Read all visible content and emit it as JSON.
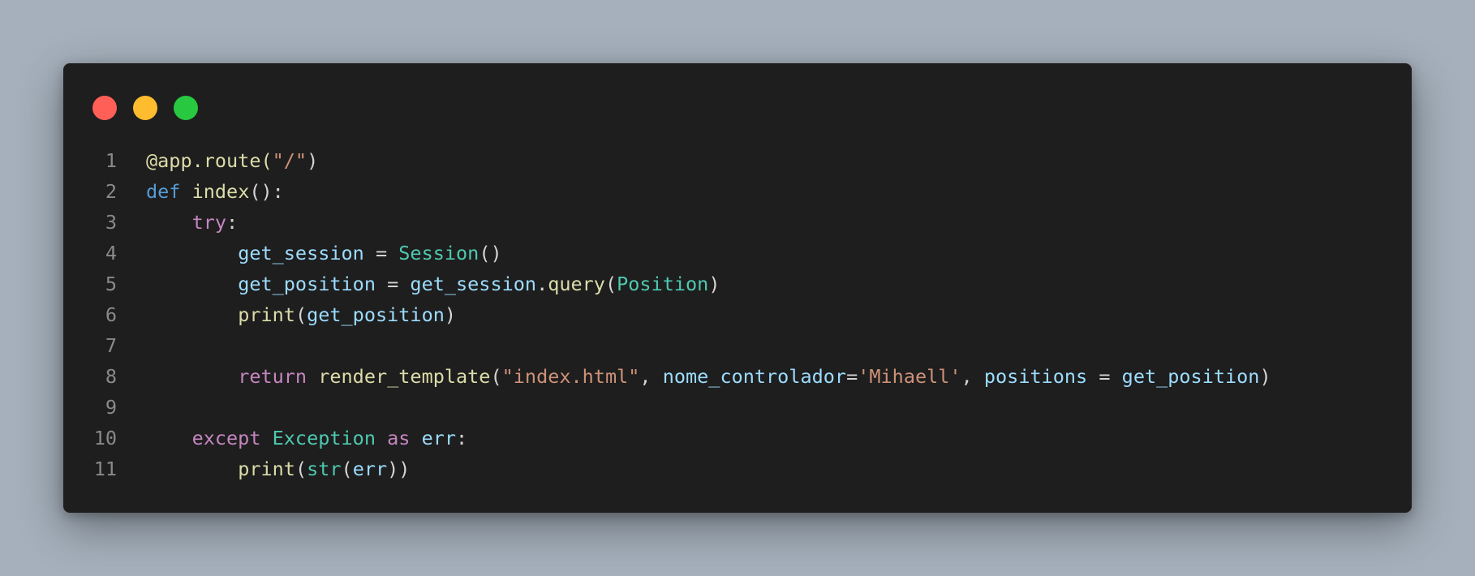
{
  "colors": {
    "background": "#a5b0bc",
    "window": "#1e1e1e",
    "close": "#ff5f57",
    "minimize": "#febc2e",
    "zoom": "#28c840"
  },
  "window_controls": [
    "close-dot",
    "minimize-dot",
    "zoom-dot"
  ],
  "code": {
    "lines": [
      {
        "num": "1",
        "tokens": [
          {
            "t": "dec",
            "v": "@app.route("
          },
          {
            "t": "str",
            "v": "\"/\""
          },
          {
            "t": "pun",
            "v": ")"
          }
        ]
      },
      {
        "num": "2",
        "tokens": [
          {
            "t": "kw",
            "v": "def"
          },
          {
            "t": "pun",
            "v": " "
          },
          {
            "t": "fn",
            "v": "index"
          },
          {
            "t": "pun",
            "v": "():"
          }
        ]
      },
      {
        "num": "3",
        "tokens": [
          {
            "t": "pun",
            "v": "    "
          },
          {
            "t": "ctl",
            "v": "try"
          },
          {
            "t": "pun",
            "v": ":"
          }
        ]
      },
      {
        "num": "4",
        "tokens": [
          {
            "t": "pun",
            "v": "        "
          },
          {
            "t": "var",
            "v": "get_session"
          },
          {
            "t": "pun",
            "v": " = "
          },
          {
            "t": "cls",
            "v": "Session"
          },
          {
            "t": "pun",
            "v": "()"
          }
        ]
      },
      {
        "num": "5",
        "tokens": [
          {
            "t": "pun",
            "v": "        "
          },
          {
            "t": "var",
            "v": "get_position"
          },
          {
            "t": "pun",
            "v": " = "
          },
          {
            "t": "var",
            "v": "get_session"
          },
          {
            "t": "pun",
            "v": "."
          },
          {
            "t": "fn",
            "v": "query"
          },
          {
            "t": "pun",
            "v": "("
          },
          {
            "t": "cls",
            "v": "Position"
          },
          {
            "t": "pun",
            "v": ")"
          }
        ]
      },
      {
        "num": "6",
        "tokens": [
          {
            "t": "pun",
            "v": "        "
          },
          {
            "t": "fn",
            "v": "print"
          },
          {
            "t": "pun",
            "v": "("
          },
          {
            "t": "var",
            "v": "get_position"
          },
          {
            "t": "pun",
            "v": ")"
          }
        ]
      },
      {
        "num": "7",
        "tokens": []
      },
      {
        "num": "8",
        "tokens": [
          {
            "t": "pun",
            "v": "        "
          },
          {
            "t": "ctl",
            "v": "return"
          },
          {
            "t": "pun",
            "v": " "
          },
          {
            "t": "fn",
            "v": "render_template"
          },
          {
            "t": "pun",
            "v": "("
          },
          {
            "t": "str",
            "v": "\"index.html\""
          },
          {
            "t": "pun",
            "v": ", "
          },
          {
            "t": "var",
            "v": "nome_controlador"
          },
          {
            "t": "pun",
            "v": "="
          },
          {
            "t": "str",
            "v": "'Mihaell'"
          },
          {
            "t": "pun",
            "v": ", "
          },
          {
            "t": "var",
            "v": "positions"
          },
          {
            "t": "pun",
            "v": " = "
          },
          {
            "t": "var",
            "v": "get_position"
          },
          {
            "t": "pun",
            "v": ")"
          }
        ]
      },
      {
        "num": "9",
        "tokens": []
      },
      {
        "num": "10",
        "tokens": [
          {
            "t": "pun",
            "v": "    "
          },
          {
            "t": "ctl",
            "v": "except"
          },
          {
            "t": "pun",
            "v": " "
          },
          {
            "t": "cls",
            "v": "Exception"
          },
          {
            "t": "pun",
            "v": " "
          },
          {
            "t": "ctl",
            "v": "as"
          },
          {
            "t": "pun",
            "v": " "
          },
          {
            "t": "var",
            "v": "err"
          },
          {
            "t": "pun",
            "v": ":"
          }
        ]
      },
      {
        "num": "11",
        "tokens": [
          {
            "t": "pun",
            "v": "        "
          },
          {
            "t": "fn",
            "v": "print"
          },
          {
            "t": "pun",
            "v": "("
          },
          {
            "t": "cls",
            "v": "str"
          },
          {
            "t": "pun",
            "v": "("
          },
          {
            "t": "var",
            "v": "err"
          },
          {
            "t": "pun",
            "v": "))"
          }
        ]
      }
    ]
  }
}
